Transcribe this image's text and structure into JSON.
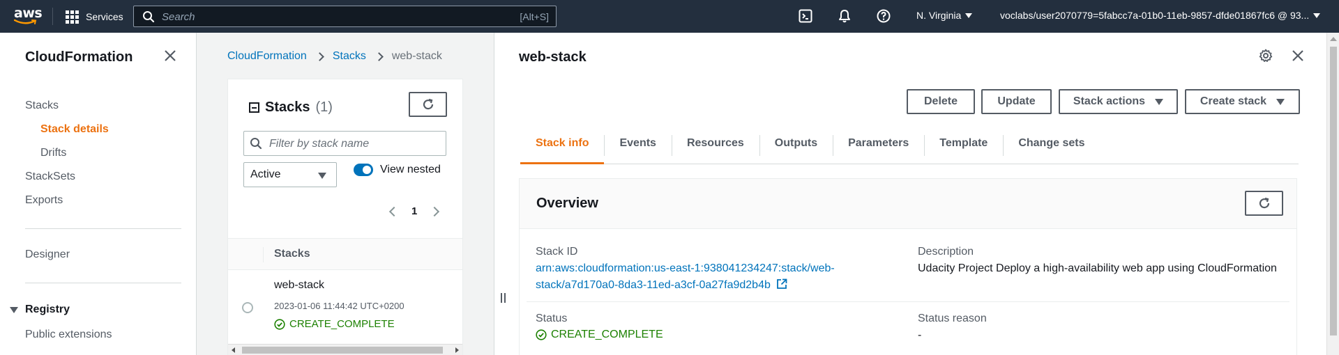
{
  "topbar": {
    "logo_text": "aws",
    "services_label": "Services",
    "search_placeholder": "Search",
    "search_shortcut": "[Alt+S]",
    "region": "N. Virginia",
    "account": "voclabs/user2070779=5fabcc7a-01b0-11eb-9857-dfde01867fc6 @ 93..."
  },
  "nav": {
    "title": "CloudFormation",
    "items": [
      {
        "label": "Stacks"
      },
      {
        "label": "Stack details",
        "active": true
      },
      {
        "label": "Drifts"
      },
      {
        "label": "StackSets"
      },
      {
        "label": "Exports"
      },
      {
        "label": "Designer"
      },
      {
        "label": "Public extensions"
      }
    ],
    "registry_label": "Registry"
  },
  "breadcrumb": [
    "CloudFormation",
    "Stacks",
    "web-stack"
  ],
  "stack_list": {
    "title": "Stacks",
    "count": "(1)",
    "filter_placeholder": "Filter by stack name",
    "status_filter": "Active",
    "view_nested_label": "View nested",
    "view_nested_on": true,
    "page": "1",
    "column_header": "Stacks",
    "rows": [
      {
        "name": "web-stack",
        "created": "2023-01-06 11:44:42 UTC+0200",
        "status": "CREATE_COMPLETE"
      }
    ]
  },
  "detail": {
    "title": "web-stack",
    "actions": {
      "delete": "Delete",
      "update": "Update",
      "stack_actions": "Stack actions",
      "create_stack": "Create stack"
    },
    "tabs": [
      "Stack info",
      "Events",
      "Resources",
      "Outputs",
      "Parameters",
      "Template",
      "Change sets"
    ],
    "active_tab": "Stack info",
    "overview": {
      "title": "Overview",
      "stack_id_label": "Stack ID",
      "stack_id_line1": "arn:aws:cloudformation:us-east-1:938041234247:stack/web-",
      "stack_id_line2": "stack/a7d170a0-8da3-11ed-a3cf-0a27fa9d2b4b",
      "description_label": "Description",
      "description": "Udacity Project Deploy a high-availability web app using CloudFormation",
      "status_label": "Status",
      "status": "CREATE_COMPLETE",
      "status_reason_label": "Status reason",
      "status_reason": "-"
    }
  },
  "colors": {
    "topbar_bg": "#232f3e",
    "accent": "#ec7211",
    "link": "#0073bb",
    "success": "#1d8102"
  }
}
